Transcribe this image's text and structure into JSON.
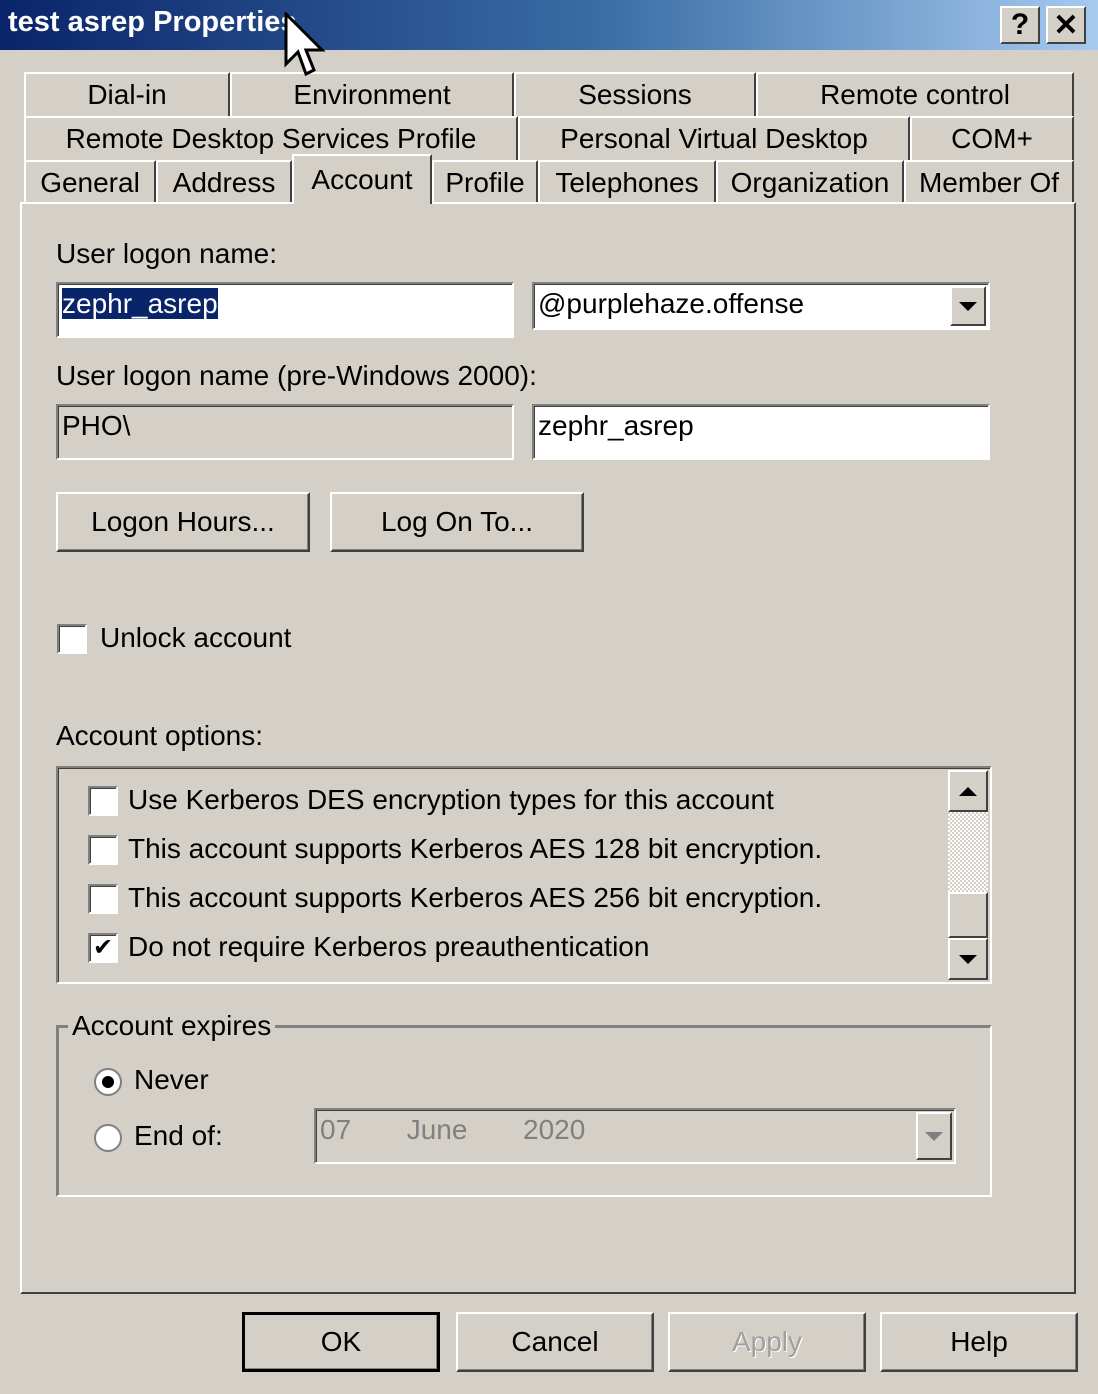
{
  "window": {
    "title": "test asrep Properties",
    "help_button": "?",
    "close_button": "✕"
  },
  "tabs": {
    "row1": [
      "Dial-in",
      "Environment",
      "Sessions",
      "Remote control"
    ],
    "row2": [
      "Remote Desktop Services Profile",
      "Personal Virtual Desktop",
      "COM+"
    ],
    "row3": [
      "General",
      "Address",
      "Account",
      "Profile",
      "Telephones",
      "Organization",
      "Member Of"
    ],
    "active": "Account"
  },
  "account": {
    "logon_name_label": "User logon name:",
    "logon_name_value": "zephr_asrep",
    "domain_value": "@purplehaze.offense",
    "pre2000_label": "User logon name (pre-Windows 2000):",
    "pre2000_domain": "PHO\\",
    "pre2000_user": "zephr_asrep",
    "logon_hours_button": "Logon Hours...",
    "log_on_to_button": "Log On To...",
    "unlock_label": "Unlock account",
    "options_label": "Account options:",
    "options": [
      {
        "label": "Use Kerberos DES encryption types for this account",
        "checked": false
      },
      {
        "label": "This account supports Kerberos AES 128 bit encryption.",
        "checked": false
      },
      {
        "label": "This account supports Kerberos AES 256 bit encryption.",
        "checked": false
      },
      {
        "label": "Do not require Kerberos preauthentication",
        "checked": true
      }
    ],
    "check_mark": "✔"
  },
  "expires": {
    "group_label": "Account expires",
    "never_label": "Never",
    "end_of_label": "End of:",
    "selected": "never",
    "date_day": "07",
    "date_month": "June",
    "date_year": "2020"
  },
  "footer": {
    "ok": "OK",
    "cancel": "Cancel",
    "apply": "Apply",
    "help": "Help"
  }
}
